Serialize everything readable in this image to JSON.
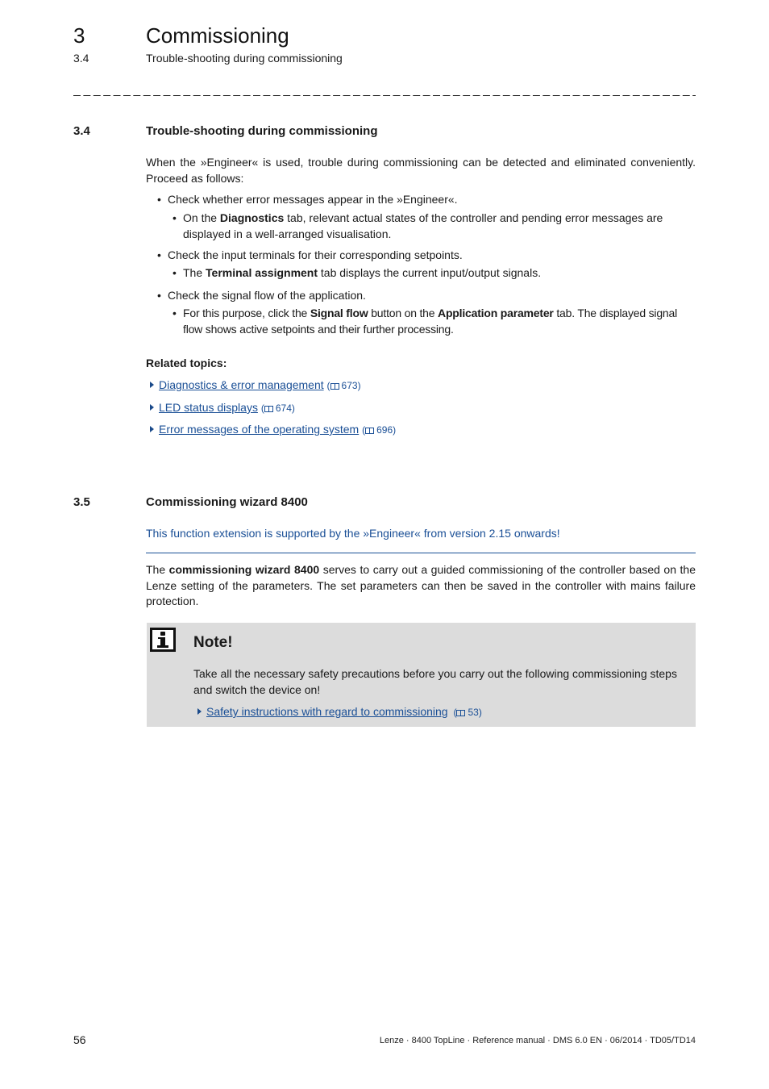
{
  "header": {
    "chapter_number": "3",
    "chapter_title": "Commissioning",
    "section_number": "3.4",
    "section_title": "Trouble-shooting during commissioning"
  },
  "section_34": {
    "number": "3.4",
    "title": "Trouble-shooting during commissioning",
    "intro": "When the »Engineer« is used, trouble during commissioning can be detected and eliminated conveniently. Proceed as follows:",
    "bullets": [
      {
        "text": "Check whether error messages appear in the »Engineer«.",
        "sub": {
          "pre": "On the ",
          "bold": "Diagnostics",
          "post": " tab, relevant actual states of the controller and pending error messages are displayed in a well-arranged visualisation."
        }
      },
      {
        "text": "Check the input terminals for their corresponding setpoints.",
        "sub": {
          "pre": "The ",
          "bold": "Terminal assignment",
          "post": " tab displays the current input/output signals."
        }
      },
      {
        "text": "Check the signal flow of the application.",
        "sub": {
          "pre": "For this purpose, click the ",
          "bold": "Signal flow",
          "mid": " button on the ",
          "bold2": "Application parameter",
          "post": " tab. The displayed signal flow shows active setpoints and their further processing."
        }
      }
    ],
    "related_heading": "Related topics:",
    "related_links": [
      {
        "label": "Diagnostics & error management",
        "page": "673"
      },
      {
        "label": "LED status displays",
        "page": "674"
      },
      {
        "label": "Error messages of the operating system",
        "page": "696"
      }
    ]
  },
  "section_35": {
    "number": "3.5",
    "title": "Commissioning wizard 8400",
    "version_note": "This function extension is supported by the »Engineer« from version 2.15 onwards!",
    "para_pre": "The ",
    "para_bold": "commissioning wizard 8400",
    "para_post": " serves to carry out a guided commissioning of the controller based on the Lenze setting of the parameters. The set parameters can then be saved in the controller with mains failure protection.",
    "note": {
      "icon": "info-icon",
      "title": "Note!",
      "text": "Take all the necessary safety precautions before you carry out the following commissioning steps and switch the device on!",
      "link_label": "Safety instructions with regard to commissioning",
      "link_page": "53"
    }
  },
  "footer": {
    "page_number": "56",
    "doc_info": "Lenze · 8400 TopLine · Reference manual · DMS 6.0 EN · 06/2014 · TD05/TD14"
  },
  "colors": {
    "link": "#1a4f96",
    "note_background": "#dcdcdc",
    "text": "#1a1a1a"
  }
}
